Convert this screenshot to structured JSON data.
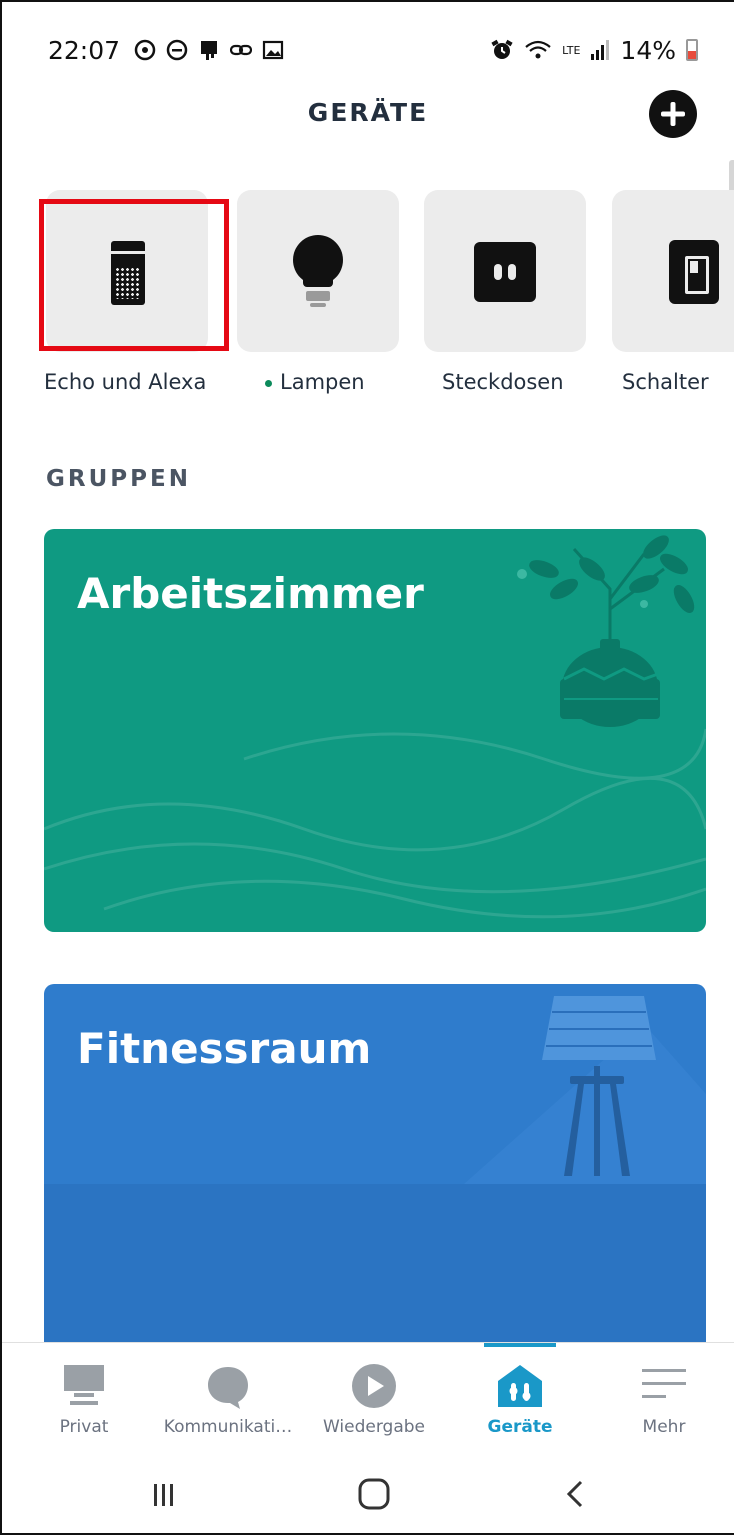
{
  "status_bar": {
    "time": "22:07",
    "left_icons": [
      "sync-icon",
      "dnd-icon",
      "notification-icon",
      "link-icon",
      "gallery-icon"
    ],
    "right_icons": [
      "alarm-icon",
      "wifi-icon",
      "lte-icon",
      "signal-icon"
    ],
    "battery_percent": "14%",
    "lte": "LTE"
  },
  "header": {
    "title": "GERÄTE",
    "add_icon": "plus-icon"
  },
  "categories": [
    {
      "label": "Echo und Alexa",
      "icon": "echo-device-icon",
      "active": false
    },
    {
      "label": "Lampen",
      "icon": "lightbulb-icon",
      "active": true
    },
    {
      "label": "Steckdosen",
      "icon": "plug-icon",
      "active": false
    },
    {
      "label": "Schalter",
      "icon": "switch-icon",
      "active": false
    }
  ],
  "groups": {
    "heading": "GRUPPEN",
    "items": [
      {
        "name": "Arbeitszimmer",
        "color": "#0f9a82"
      },
      {
        "name": "Fitnessraum",
        "color": "#2f7ccc"
      }
    ]
  },
  "bottom_nav": {
    "items": [
      {
        "label": "Privat",
        "icon": "home-icon"
      },
      {
        "label": "Kommunikati…",
        "icon": "chat-icon"
      },
      {
        "label": "Wiedergabe",
        "icon": "play-icon"
      },
      {
        "label": "Geräte",
        "icon": "devices-icon",
        "active": true
      },
      {
        "label": "Mehr",
        "icon": "menu-icon"
      }
    ]
  },
  "colors": {
    "accent": "#1a98c8",
    "highlight": "#e50914",
    "lampen_dot": "#0c8a5b"
  }
}
